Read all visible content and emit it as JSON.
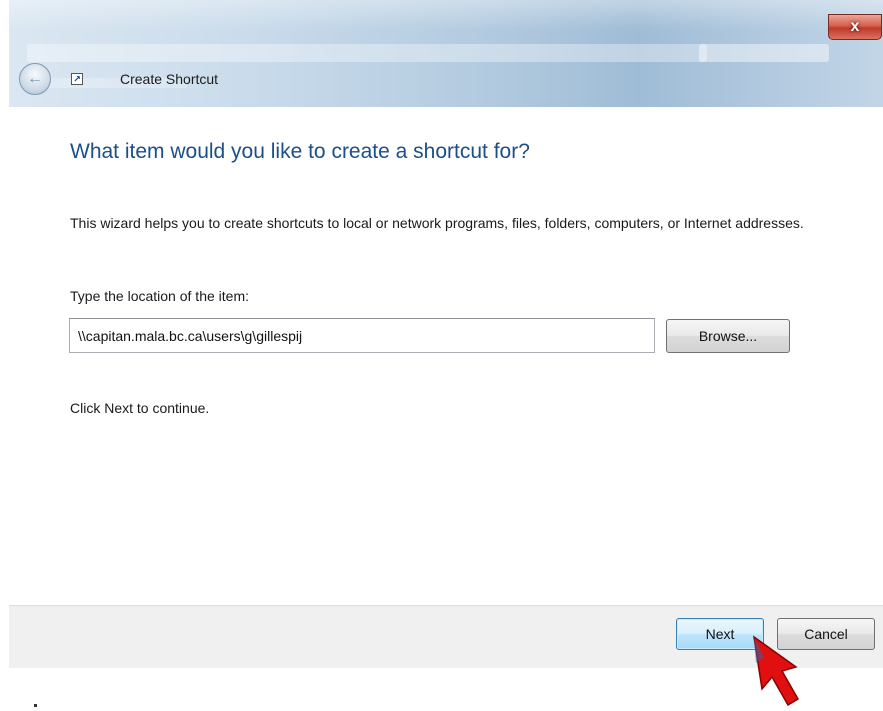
{
  "window": {
    "title": "Create Shortcut",
    "close_glyph": "x",
    "back_glyph": "←",
    "title_icon": "shortcut-arrow-icon"
  },
  "wizard": {
    "heading": "What item would you like to create a shortcut for?",
    "description": "This wizard helps you to create shortcuts to local or network programs, files, folders, computers, or Internet addresses.",
    "location_label": "Type the location of the item:",
    "location_value": "\\\\capitan.mala.bc.ca\\users\\g\\gillespij",
    "browse_label": "Browse...",
    "continue_text": "Click Next to continue."
  },
  "footer": {
    "next_label": "Next",
    "cancel_label": "Cancel"
  },
  "colors": {
    "heading": "#1b4f8a",
    "annotation_arrow": "#e01010",
    "close_button": "#c0392b"
  }
}
